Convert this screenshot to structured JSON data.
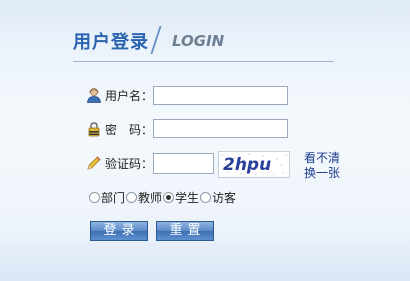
{
  "header": {
    "title_cn": "用户登录",
    "title_en": "LOGIN"
  },
  "form": {
    "username_label": "用户名：",
    "password_label": "密　码：",
    "captcha_label": "验证码：",
    "username_value": "",
    "password_value": "",
    "captcha_value": "",
    "captcha_image_text": "2hpu",
    "refresh_line1": "看不清",
    "refresh_line2": "换一张"
  },
  "roles": {
    "selected": "学生",
    "options": [
      "部门",
      "教师",
      "学生",
      "访客"
    ]
  },
  "buttons": {
    "login": "登录",
    "reset": "重置"
  },
  "icons": {
    "username": "user-icon",
    "password": "lock-icon",
    "captcha": "pencil-icon"
  },
  "colors": {
    "title": "#2a64b0",
    "title_en": "#6f7f92",
    "button": "#4f80c0",
    "link": "#1c3c8c"
  }
}
